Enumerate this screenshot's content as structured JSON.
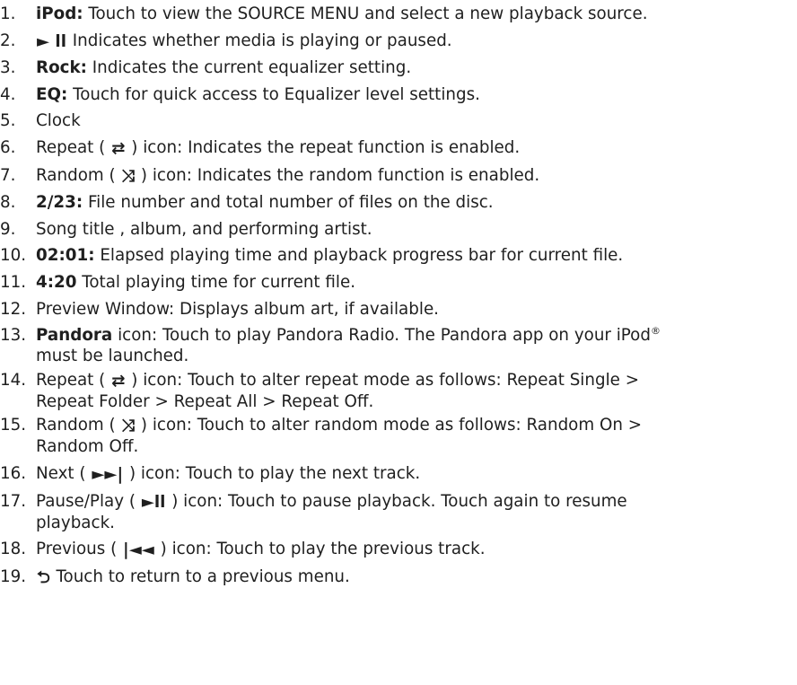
{
  "items": [
    {
      "num": "1.",
      "pre": "",
      "bold": "iPod:",
      "icon": "",
      "post": " Touch to view the SOURCE MENU and select a new playback source."
    },
    {
      "num": "2.",
      "pre": "",
      "bold": "",
      "icon": "► ll",
      "post": " Indicates whether media is playing or paused."
    },
    {
      "num": "3.",
      "pre": "",
      "bold": "Rock:",
      "icon": "",
      "post": " Indicates the current equalizer setting."
    },
    {
      "num": "4.",
      "pre": "",
      "bold": "EQ:",
      "icon": "",
      "post": " Touch for quick access to Equalizer level settings."
    },
    {
      "num": "5.",
      "pre": "Clock",
      "bold": "",
      "icon": "",
      "post": ""
    },
    {
      "num": "6.",
      "pre": "Repeat ( ",
      "bold": "",
      "icon": "⇄",
      "post": " ) icon: Indicates the repeat function is enabled."
    },
    {
      "num": "7.",
      "pre": "Random ( ",
      "bold": "",
      "icon": "⤨",
      "post": " ) icon: Indicates the random function is enabled."
    },
    {
      "num": "8.",
      "pre": "",
      "bold": "2/23:",
      "icon": "",
      "post": " File number and total number of files on the disc."
    },
    {
      "num": "9.",
      "pre": "Song title , album, and performing artist.",
      "bold": "",
      "icon": "",
      "post": ""
    },
    {
      "num": "10.",
      "pre": "",
      "bold": "02:01:",
      "icon": "",
      "post": " Elapsed playing time and playback progress bar for current file."
    },
    {
      "num": "11.",
      "pre": "",
      "bold": "4:20",
      "icon": "",
      "post": " Total playing time for current file."
    },
    {
      "num": "12.",
      "pre": " Preview Window: Displays album art, if available.",
      "bold": "",
      "icon": "",
      "post": ""
    },
    {
      "num": "13.",
      "pre": "",
      "bold": "Pandora",
      "icon": "",
      "post": " icon: Touch to play Pandora Radio. The Pandora app on your iPod",
      "sup": "®",
      "post2": "must be launched."
    },
    {
      "num": "14.",
      "pre": "Repeat ( ",
      "bold": "",
      "icon": "⇄",
      "post": " ) icon: Touch to alter repeat mode as follows: Repeat Single >",
      "post2": "Repeat Folder > Repeat All > Repeat Off."
    },
    {
      "num": "15.",
      "pre": "Random ( ",
      "bold": "",
      "icon": "⤨",
      "post": " ) icon: Touch to alter random mode as follows: Random On >",
      "post2": "Random Off."
    },
    {
      "num": "16.",
      "pre": "Next ( ",
      "bold": "",
      "icon": "►►|",
      "post": " ) icon: Touch to play the next track."
    },
    {
      "num": "17.",
      "pre": "Pause/Play ( ",
      "bold": "",
      "icon": "►ll",
      "post": " ) icon: Touch to pause playback. Touch again to resume",
      "post2": "playback."
    },
    {
      "num": "18.",
      "pre": "Previous ( ",
      "bold": "",
      "icon": "|◄◄",
      "post": " ) icon: Touch to play the previous track."
    },
    {
      "num": "19.",
      "pre": "",
      "bold": "",
      "icon": "⮌",
      "post": " Touch to return to a previous menu."
    }
  ]
}
